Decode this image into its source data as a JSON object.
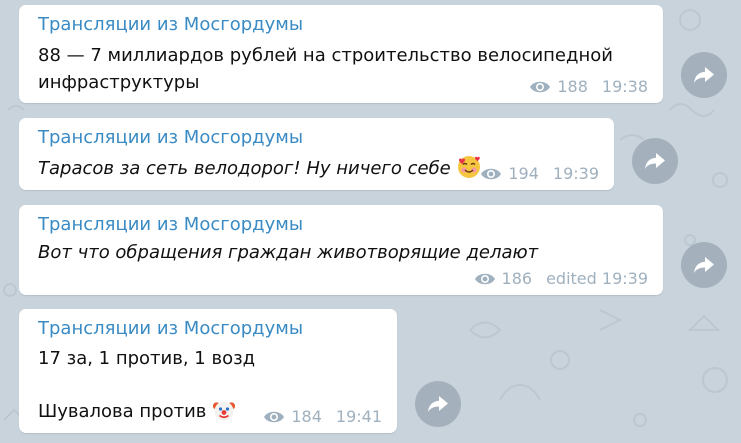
{
  "messages": [
    {
      "sender": "Трансляции из Мосгордумы",
      "line1": "88 — 7 миллиардов рублей на строительство велосипедной",
      "line2": "инфраструктуры",
      "views": "188",
      "time": "19:38"
    },
    {
      "sender": "Трансляции из Мосгордумы",
      "line1": "Тарасов за сеть велодорог! Ну ничего себе",
      "emoji": "smiling-face-with-hearts",
      "views": "194",
      "time": "19:39"
    },
    {
      "sender": "Трансляции из Мосгордумы",
      "line1": "Вот что обращения граждан животворящие делают",
      "views": "186",
      "time": "edited 19:39"
    },
    {
      "sender": "Трансляции из Мосгордумы",
      "line1": "17 за, 1 против, 1 возд",
      "line2": "Шувалова против",
      "emoji": "clown-face",
      "views": "184",
      "time": "19:41"
    }
  ],
  "colors": {
    "background": "#c9d3db",
    "sender": "#3a8bc4",
    "meta": "#9fb0be",
    "share_button": "#a4b1bc"
  },
  "icons": {
    "views": "eye-icon",
    "share": "share-arrow-icon"
  }
}
